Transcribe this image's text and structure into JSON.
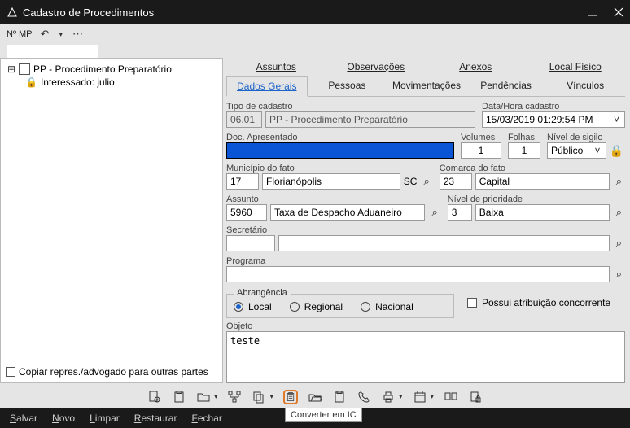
{
  "window": {
    "title": "Cadastro de Procedimentos"
  },
  "subbar": {
    "mp_label": "Nº MP"
  },
  "tree": {
    "root_label": "PP - Procedimento Preparatório",
    "child_label": "Interessado: julio"
  },
  "left_footer": {
    "copy_repres": "Copiar repres./advogado para outras partes"
  },
  "tabs_top": {
    "assuntos": "Assuntos",
    "observacoes": "Observações",
    "anexos": "Anexos",
    "local_fisico": "Local Físico"
  },
  "tabs_bottom": {
    "dados_gerais": "Dados Gerais",
    "pessoas": "Pessoas",
    "movimentacoes": "Movimentações",
    "pendencias": "Pendências",
    "vinculos": "Vínculos"
  },
  "fields": {
    "tipo_cadastro_label": "Tipo de cadastro",
    "tipo_cadastro_code": "06.01",
    "tipo_cadastro_desc": "PP - Procedimento Preparatório",
    "datahora_label": "Data/Hora cadastro",
    "datahora_value": "15/03/2019 01:29:54 PM",
    "doc_apresentado_label": "Doc. Apresentado",
    "volumes_label": "Volumes",
    "volumes_value": "1",
    "folhas_label": "Folhas",
    "folhas_value": "1",
    "nivel_sigilo_label": "Nível de sigilo",
    "nivel_sigilo_value": "Público",
    "municipio_label": "Município do fato",
    "municipio_code": "17",
    "municipio_name": "Florianópolis",
    "municipio_uf": "SC",
    "comarca_label": "Comarca do fato",
    "comarca_code": "23",
    "comarca_name": "Capital",
    "assunto_label": "Assunto",
    "assunto_code": "5960",
    "assunto_name": "Taxa de Despacho Aduaneiro",
    "nivel_prioridade_label": "Nível de prioridade",
    "nivel_prioridade_code": "3",
    "nivel_prioridade_name": "Baixa",
    "secretario_label": "Secretário",
    "programa_label": "Programa",
    "abrangencia_label": "Abrangência",
    "abrangencia_local": "Local",
    "abrangencia_regional": "Regional",
    "abrangencia_nacional": "Nacional",
    "atribuicao_concorrente": "Possui atribuição concorrente",
    "objeto_label": "Objeto",
    "objeto_value": "teste"
  },
  "tooltip": {
    "converter_ic": "Converter em IC"
  },
  "cmdbar": {
    "salvar": "Salvar",
    "salvar_ul": "S",
    "novo": "Novo",
    "novo_ul": "N",
    "limpar": "Limpar",
    "limpar_ul": "L",
    "restaurar": "Restaurar",
    "restaurar_ul": "R",
    "fechar": "Fechar",
    "fechar_ul": "F"
  }
}
